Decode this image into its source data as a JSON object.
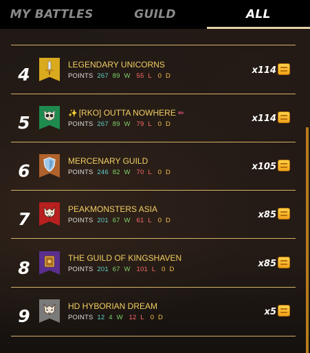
{
  "tabs": [
    {
      "label": "MY BATTLES",
      "active": false
    },
    {
      "label": "GUILD",
      "active": false
    },
    {
      "label": "ALL",
      "active": true
    }
  ],
  "stats_labels": {
    "points": "POINTS",
    "wins": "W",
    "losses": "L",
    "draws": "D"
  },
  "rows": [
    {
      "rank": "4",
      "name": "LEGENDARY UNICORNS",
      "prefix": "",
      "suffix": "",
      "points": "267",
      "wins": "89",
      "losses": "55",
      "draws": "0",
      "multiplier": "x114",
      "banner_color": "#d9a91e",
      "icon": "sword-icon"
    },
    {
      "rank": "5",
      "name": "[RKO] OUTTA NOWHERE",
      "prefix": "✨",
      "suffix": "✏",
      "points": "267",
      "wins": "89",
      "losses": "79",
      "draws": "0",
      "multiplier": "x114",
      "banner_color": "#1f8a4e",
      "icon": "owl-icon"
    },
    {
      "rank": "6",
      "name": "MERCENARY GUILD",
      "prefix": "",
      "suffix": "",
      "points": "246",
      "wins": "82",
      "losses": "70",
      "draws": "0",
      "multiplier": "x105",
      "banner_color": "#b0622c",
      "icon": "shield-icon"
    },
    {
      "rank": "7",
      "name": "PEAKMONSTERS ASIA",
      "prefix": "",
      "suffix": "",
      "points": "201",
      "wins": "67",
      "losses": "61",
      "draws": "0",
      "multiplier": "x85",
      "banner_color": "#b81f1f",
      "icon": "wolf-icon"
    },
    {
      "rank": "8",
      "name": "THE GUILD OF KINGSHAVEN",
      "prefix": "",
      "suffix": "",
      "points": "201",
      "wins": "67",
      "losses": "101",
      "draws": "0",
      "multiplier": "x85",
      "banner_color": "#5a2f8f",
      "icon": "book-icon"
    },
    {
      "rank": "9",
      "name": "HD HYBORIAN DREAM",
      "prefix": "",
      "suffix": "",
      "points": "12",
      "wins": "4",
      "losses": "12",
      "draws": "0",
      "multiplier": "x5",
      "banner_color": "#7a7a7a",
      "icon": "wolf-icon"
    }
  ]
}
